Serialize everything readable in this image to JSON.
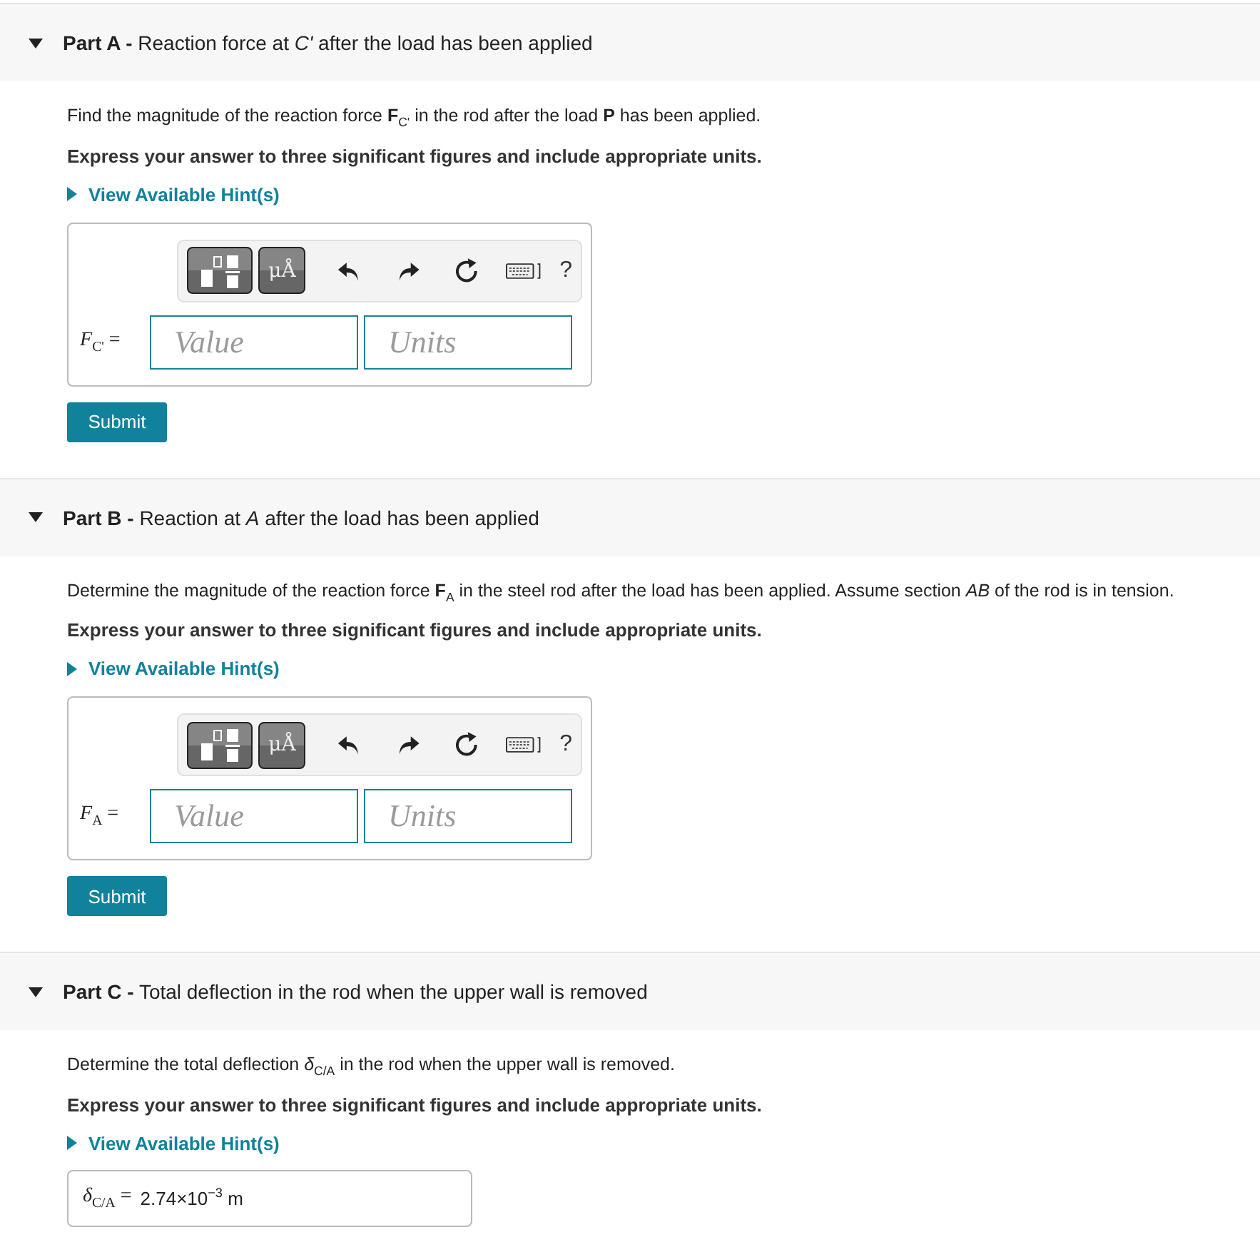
{
  "parts": [
    {
      "kind": "input",
      "expanded": true,
      "label": "Part A -",
      "title": "Reaction force at *C'* after the load has been applied",
      "question": "Find the magnitude of the reaction force **F**$_{C'}$ in the rod after the load **P** has been applied.",
      "instruction": "Express your answer to three significant figures and include appropriate units.",
      "hint": "View Available Hint(s)",
      "units_button": "μÅ",
      "help_button": "?",
      "symbol": "*F*$_{C'}$ =",
      "value_placeholder": "Value",
      "units_placeholder": "Units",
      "submit": "Submit"
    },
    {
      "kind": "input",
      "expanded": true,
      "label": "Part B -",
      "title": "Reaction at *A* after the load has been applied",
      "question": "Determine the magnitude of the reaction force **F**$_{A}$ in the steel rod after the load has been applied. Assume section *AB* of the rod is in tension.",
      "instruction": "Express your answer to three significant figures and include appropriate units.",
      "hint": "View Available Hint(s)",
      "units_button": "μÅ",
      "help_button": "?",
      "symbol": "*F*$_{A}$ =",
      "value_placeholder": "Value",
      "units_placeholder": "Units",
      "submit": "Submit"
    },
    {
      "kind": "answer",
      "expanded": true,
      "label": "Part C -",
      "title": "Total deflection in the rod when the upper wall is removed",
      "question": "Determine the total deflection *δ*$_{C/A}$ in the rod when the upper wall is removed.",
      "instruction": "Express your answer to three significant figures and include appropriate units.",
      "hint": "View Available Hint(s)",
      "symbol": "*δ*$_{C/A}$ =",
      "answer": "2.74×10$^{−3}$ m"
    }
  ]
}
